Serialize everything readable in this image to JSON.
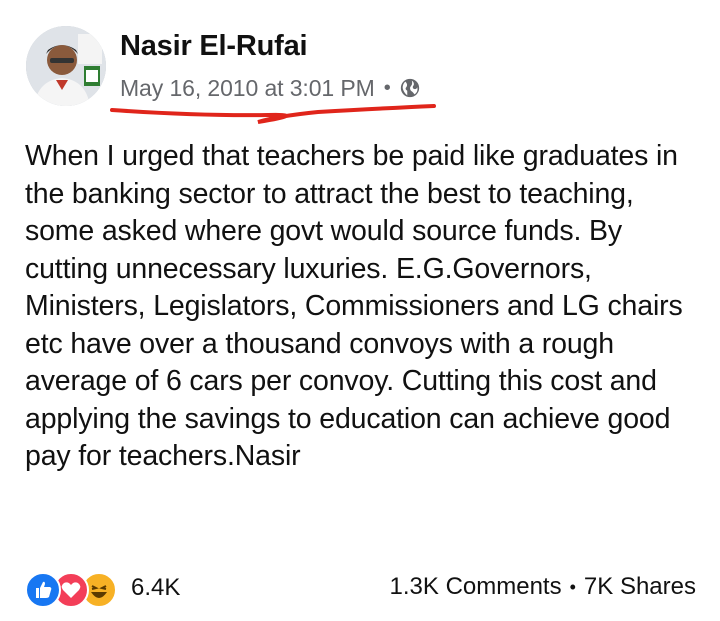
{
  "post": {
    "author": "Nasir El-Rufai",
    "timestamp": "May 16, 2010 at 3:01 PM",
    "separator": "•",
    "privacy_icon": "globe-icon",
    "text": "When I urged that teachers be paid like graduates in the banking sector to attract the best to teaching, some asked where govt would source funds. By cutting unnecessary luxuries. E.G.Governors, Ministers, Legislators, Commissioners and LG chairs etc have over a thousand convoys with a rough average of 6 cars per convoy. Cutting this cost and applying the savings to education can achieve good pay for teachers.Nasir"
  },
  "reactions": {
    "icons": [
      "like-icon",
      "love-icon",
      "haha-icon"
    ],
    "count": "6.4K"
  },
  "engagement": {
    "comments": "1.3K Comments",
    "separator": "•",
    "shares": "7K Shares"
  },
  "colors": {
    "like": "#1877f2",
    "love": "#f33e58",
    "haha": "#f7b125",
    "annotation": "#e0251b"
  }
}
